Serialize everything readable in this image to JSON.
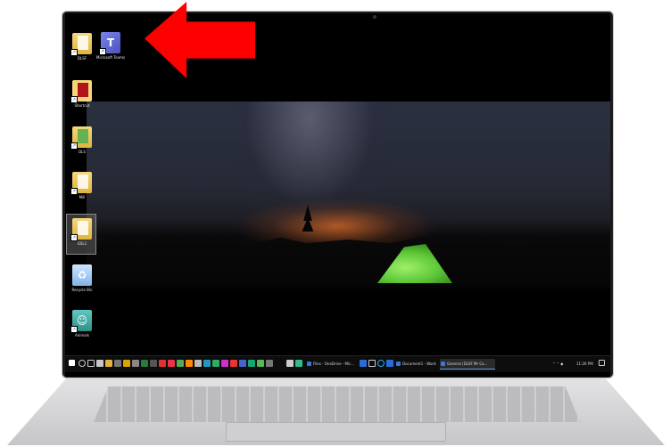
{
  "desktop": {
    "icons": [
      {
        "label": "DLSF",
        "icon": "folder-icon"
      },
      {
        "label": "Microsoft Teams",
        "icon": "teams-icon"
      },
      {
        "label": "Shortcut",
        "icon": "pdf-folder-icon"
      },
      {
        "label": "DLS",
        "icon": "folder-icon"
      },
      {
        "label": "Mill",
        "icon": "folder-icon"
      },
      {
        "label": "GSL1",
        "icon": "folder-icon"
      },
      {
        "label": "Recycle Bin",
        "icon": "recycle-bin-icon"
      },
      {
        "label": "Animals",
        "icon": "animal-icon"
      }
    ]
  },
  "taskbar": {
    "apps": [
      {
        "label": "Files - OneDrive - Mic...",
        "active": false
      },
      {
        "label": "Document1 - Word",
        "active": false
      },
      {
        "label": "General (DLSF Mr Co...",
        "active": true
      }
    ],
    "clock": "11:26 PM"
  },
  "colors": {
    "arrow": "#ff0000",
    "taskbar": "#0d0d0d",
    "tent": "#5cc637"
  }
}
